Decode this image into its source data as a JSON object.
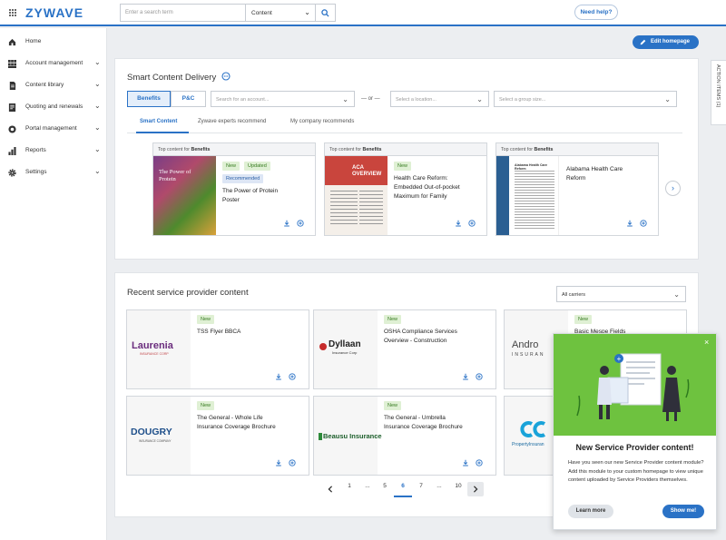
{
  "header": {
    "logo": "ZYWAVE",
    "search_placeholder": "Enter a search term",
    "search_scope": "Content",
    "help": "Need help?"
  },
  "sidebar": {
    "items": [
      {
        "label": "Home",
        "icon": "home-icon"
      },
      {
        "label": "Account management",
        "icon": "grid-icon"
      },
      {
        "label": "Content library",
        "icon": "document-icon"
      },
      {
        "label": "Quoting and renewals",
        "icon": "quote-icon"
      },
      {
        "label": "Portal management",
        "icon": "portal-icon"
      },
      {
        "label": "Reports",
        "icon": "bar-chart-icon"
      },
      {
        "label": "Settings",
        "icon": "gear-icon"
      }
    ]
  },
  "edit_homepage": "Edit homepage",
  "action_items": "ACTION ITEMS (1)",
  "smart": {
    "title": "Smart Content Delivery",
    "seg": [
      "Benefits",
      "P&C"
    ],
    "account_placeholder": "Search for an account...",
    "or": "— or —",
    "location_placeholder": "Select a location...",
    "group_placeholder": "Select a group size...",
    "tabs": [
      "Smart Content",
      "Zywave experts recommend",
      "My company recommends"
    ],
    "hdr_prefix": "Top content for ",
    "hdr_bold": "Benefits",
    "cards": [
      {
        "badges": [
          "New",
          "Updated"
        ],
        "badge_rec": "Recommended",
        "title_l1": "The Power of Protein",
        "title_l2": "Poster",
        "thumb_text": "The Power of Protein"
      },
      {
        "badges": [
          "New"
        ],
        "title_l1": "Health Care Reform:",
        "title_l2": "Embedded Out-of-pocket",
        "title_l3": "Maximum for Family",
        "thumb_text": "ACA OVERVIEW"
      },
      {
        "title_l1": "Alabama Health Care",
        "title_l2": "Reform",
        "thumb_text": "Alabama Health Care Reform"
      }
    ]
  },
  "recent": {
    "title": "Recent service provider content",
    "filter": "All carriers",
    "badge": "New",
    "cards": [
      {
        "logo": "Laurenia",
        "logo_sub": "INSURANCE CORP",
        "title_l1": "TSS Flyer BBCA",
        "title_l2": ""
      },
      {
        "logo": "Dyllaan",
        "logo_sub": "Insurance Corp",
        "title_l1": "OSHA Compliance Services",
        "title_l2": "Overview - Construction"
      },
      {
        "logo": "Andro",
        "logo_sub": "INSURAN",
        "title_l1": "Basic Mespe Fields",
        "title_l2": ""
      },
      {
        "logo": "DOUGRY",
        "logo_sub": "INSURANCE COMPANY",
        "title_l1": "The General - Whole Life",
        "title_l2": "Insurance Coverage Brochure"
      },
      {
        "logo": "Beausu Insurance",
        "logo_sub": "",
        "title_l1": "The General - Umbrella",
        "title_l2": "Insurance Coverage Brochure"
      },
      {
        "logo": "",
        "logo_sub": "PropertyInsuran",
        "title_l1": "",
        "title_l2": ""
      }
    ],
    "pages": [
      "1",
      "...",
      "5",
      "6",
      "7",
      "...",
      "10"
    ]
  },
  "popup": {
    "title": "New Service Provider content!",
    "body": "Have you seen our new Service Provider content module? Add this module to your custom homepage to view unique content uploaded by Service Providers themselves.",
    "learn_more": "Learn more",
    "show_me": "Show me!"
  },
  "colors": {
    "accent": "#2a72c6",
    "badge_green": "#dff0d4",
    "popup_green": "#6ec23f"
  }
}
